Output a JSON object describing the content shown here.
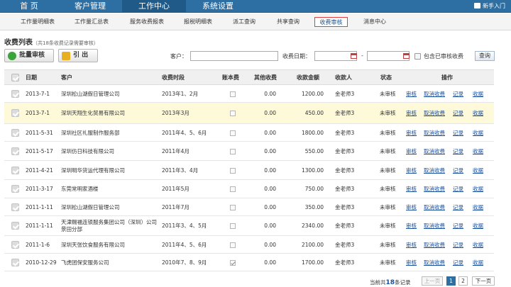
{
  "topnav": {
    "items": [
      {
        "label": "首  页"
      },
      {
        "label": "客户管理"
      },
      {
        "label": "工作中心"
      },
      {
        "label": "系统设置"
      }
    ],
    "help_label": "新手入门"
  },
  "subnav": {
    "items": [
      {
        "label": "工作量明细表"
      },
      {
        "label": "工作量汇总表"
      },
      {
        "label": "服务收费报表"
      },
      {
        "label": "报税明细表"
      },
      {
        "label": "派工查询"
      },
      {
        "label": "共享查询"
      },
      {
        "label": "收费审核"
      },
      {
        "label": "消息中心"
      }
    ]
  },
  "list": {
    "title": "收费列表",
    "subtitle": "（共18条收费记录需要审核）"
  },
  "toolbar": {
    "batch_label": "批量审核",
    "export_label": "引 出",
    "customer_label": "客户：",
    "customer_value": "",
    "date_label": "收费日期：",
    "date_from": "",
    "date_sep": "-",
    "date_to": "",
    "include_label": "包含已审核收费",
    "query_label": "查询"
  },
  "table": {
    "headers": {
      "date": "日期",
      "customer": "客户",
      "period": "收费时段",
      "account_fee": "账本费",
      "other_fee": "其他收费",
      "total": "收款金额",
      "payee": "收款人",
      "status": "状态",
      "actions": "操作"
    },
    "actions": {
      "review": "审核",
      "cancel": "取消收费",
      "record": "记录",
      "receipt": "收据"
    },
    "rows": [
      {
        "date": "2013-7-1",
        "customer": "深圳松山湖假日管理公司",
        "period": "2013年1、2月",
        "account_fee": false,
        "other_fee": "0.00",
        "total": "1200.00",
        "payee": "金老师3",
        "status": "未审核"
      },
      {
        "date": "2013-7-1",
        "customer": "深圳天翔生化贸易有限公司",
        "period": "2013年3月",
        "account_fee": false,
        "other_fee": "0.00",
        "total": "450.00",
        "payee": "金老师3",
        "status": "未审核"
      },
      {
        "date": "2011-5-31",
        "customer": "深圳社区礼服制作服务部",
        "period": "2011年4、5、6月",
        "account_fee": false,
        "other_fee": "0.00",
        "total": "1800.00",
        "payee": "金老师3",
        "status": "未审核"
      },
      {
        "date": "2011-5-17",
        "customer": "深圳仿日科技有限公司",
        "period": "2011年4月",
        "account_fee": false,
        "other_fee": "0.00",
        "total": "550.00",
        "payee": "金老师3",
        "status": "未审核"
      },
      {
        "date": "2011-4-21",
        "customer": "深圳明华货运代理有限公司",
        "period": "2011年3、4月",
        "account_fee": false,
        "other_fee": "0.00",
        "total": "1300.00",
        "payee": "金老师3",
        "status": "未审核"
      },
      {
        "date": "2011-3-17",
        "customer": "东莞常明家酒楼",
        "period": "2011年5月",
        "account_fee": false,
        "other_fee": "0.00",
        "total": "750.00",
        "payee": "金老师3",
        "status": "未审核"
      },
      {
        "date": "2011-1-11",
        "customer": "深圳松山湖假日管理公司",
        "period": "2011年7月",
        "account_fee": false,
        "other_fee": "0.00",
        "total": "350.00",
        "payee": "金老师3",
        "status": "未审核"
      },
      {
        "date": "2011-1-11",
        "customer": "天津赐福连锁服务集团公司（深圳）公司景田分部",
        "period": "2011年3、4、5月",
        "account_fee": false,
        "other_fee": "0.00",
        "total": "2340.00",
        "payee": "金老师3",
        "status": "未审核"
      },
      {
        "date": "2011-1-6",
        "customer": "深圳天张饮食服务有限公司",
        "period": "2011年4、5、6月",
        "account_fee": false,
        "other_fee": "0.00",
        "total": "2100.00",
        "payee": "金老师3",
        "status": "未审核"
      },
      {
        "date": "2010-12-29",
        "customer": "飞虎团保安服务公司",
        "period": "2010年7、8、9月",
        "account_fee": true,
        "other_fee": "0.00",
        "total": "1700.00",
        "payee": "金老师3",
        "status": "未审核"
      }
    ]
  },
  "pager": {
    "prefix": "当前共",
    "count": "18",
    "suffix": "条记录",
    "prev_label": "上一页",
    "pages": [
      "1",
      "2"
    ],
    "next_label": "下一页"
  }
}
